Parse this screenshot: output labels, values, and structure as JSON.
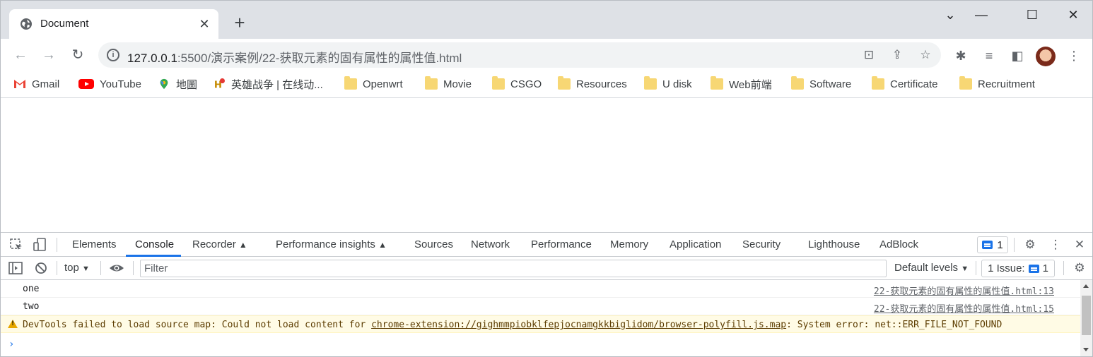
{
  "tab": {
    "title": "Document"
  },
  "address": {
    "host": "127.0.0.1",
    "path": ":5500/演示案例/22-获取元素的固有属性的属性值.html"
  },
  "bookmarks": [
    {
      "label": "Gmail",
      "icon": "gmail-icon"
    },
    {
      "label": "YouTube",
      "icon": "youtube-icon"
    },
    {
      "label": "地圖",
      "icon": "maps-icon"
    },
    {
      "label": "英雄战争 | 在线动...",
      "icon": "game-icon"
    },
    {
      "label": "Openwrt",
      "icon": "folder-icon"
    },
    {
      "label": "Movie",
      "icon": "folder-icon"
    },
    {
      "label": "CSGO",
      "icon": "folder-icon"
    },
    {
      "label": "Resources",
      "icon": "folder-icon"
    },
    {
      "label": "U disk",
      "icon": "folder-icon"
    },
    {
      "label": "Web前端",
      "icon": "folder-icon"
    },
    {
      "label": "Software",
      "icon": "folder-icon"
    },
    {
      "label": "Certificate",
      "icon": "folder-icon"
    },
    {
      "label": "Recruitment",
      "icon": "folder-icon"
    }
  ],
  "devtools": {
    "tabs": [
      "Elements",
      "Console",
      "Recorder",
      "Performance insights",
      "Sources",
      "Network",
      "Performance",
      "Memory",
      "Application",
      "Security",
      "Lighthouse",
      "AdBlock"
    ],
    "active_tab": "Console",
    "issues_count": "1",
    "context": "top",
    "filter_placeholder": "Filter",
    "levels": "Default levels",
    "issues_label": "1 Issue:",
    "issues_label_count": "1"
  },
  "console": {
    "rows": [
      {
        "message": "one",
        "source": "22-获取元素的固有属性的属性值.html:13"
      },
      {
        "message": "two",
        "source": "22-获取元素的固有属性的属性值.html:15"
      }
    ],
    "warning": {
      "prefix": "DevTools failed to load source map: Could not load content for ",
      "link": "chrome-extension://gighmmpiobklfepjocnamgkkbiglidom/browser-polyfill.js.map",
      "suffix": ": System error: net::ERR_FILE_NOT_FOUND"
    },
    "prompt": "›"
  },
  "colors": {
    "accent": "#1a73e8",
    "warning_bg": "#fffbe5",
    "tabstrip": "#dee1e6"
  }
}
